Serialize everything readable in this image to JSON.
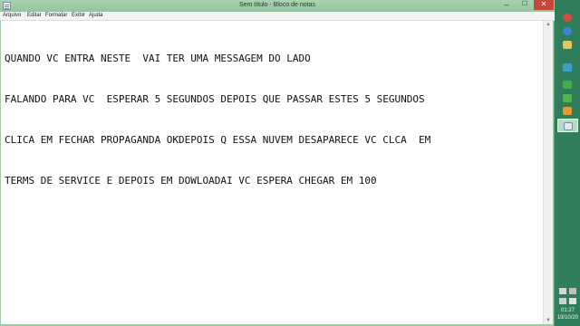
{
  "window": {
    "title": "Sem título - Bloco de notas",
    "controls": {
      "minimize": "–",
      "maximize": "☐",
      "close": "✕"
    }
  },
  "menu": {
    "items": [
      "Arquivo",
      "Editar",
      "Formatar",
      "Exibir",
      "Ajuda"
    ]
  },
  "document": {
    "lines": [
      "QUANDO VC ENTRA NESTE  VAI TER UMA MESSAGEM DO LADO",
      "FALANDO PARA VC  ESPERAR 5 SEGUNDOS DEPOIS QUE PASSAR ESTES 5 SEGUNDOS",
      "CLICA EM FECHAR PROPAGANDA OKDEPOIS Q ESSA NUVEM DESAPARECE VC CLCA  EM",
      "TERMS DE SERVICE E DEPOIS EM DOWLOADAI VC ESPERA CHEGAR EM 100"
    ]
  },
  "scrollbar": {
    "up": "▲",
    "down": "▼"
  },
  "taskbar": {
    "buttons": [
      {
        "icon": "chrome-icon",
        "color": "#d94b3c"
      },
      {
        "icon": "internet-explorer-icon",
        "color": "#3a86d4"
      },
      {
        "icon": "file-explorer-icon",
        "color": "#e8c65a"
      },
      {
        "icon": "media-player-icon",
        "color": "#3aa0c8"
      },
      {
        "icon": "app-icon-green",
        "color": "#3fae4b"
      },
      {
        "icon": "app-icon-green-2",
        "color": "#4cb84f"
      },
      {
        "icon": "app-icon-orange",
        "color": "#e39b32"
      },
      {
        "icon": "notepad-icon",
        "color": "#dfe7ef"
      }
    ],
    "tray": {
      "time": "01:27",
      "date": "19/10/20"
    }
  }
}
